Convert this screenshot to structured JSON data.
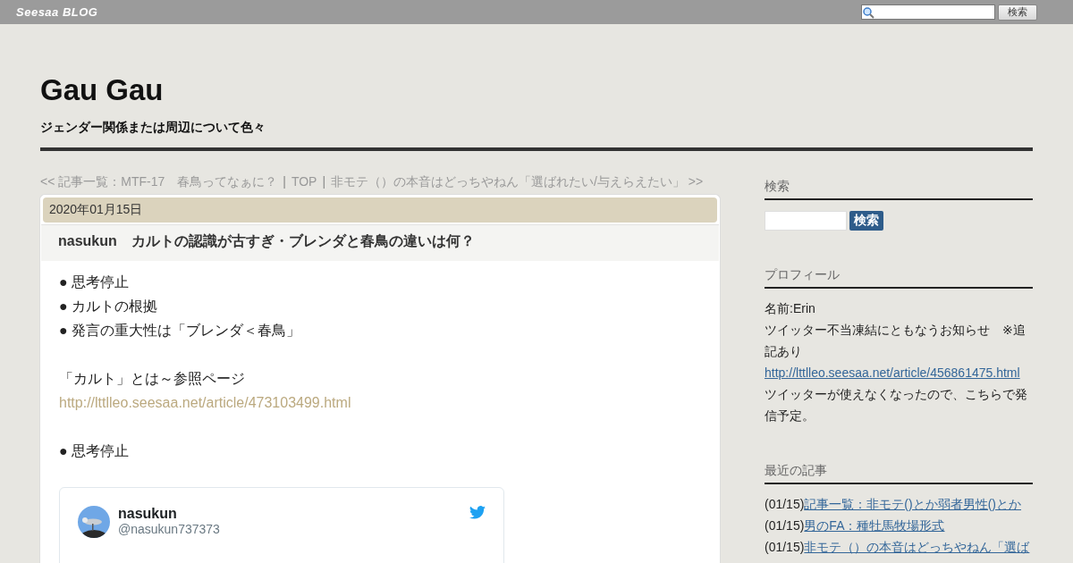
{
  "topbar": {
    "logo": "Seesaa BLOG",
    "search_button": "検索"
  },
  "blog": {
    "title": "Gau Gau",
    "subtitle": "ジェンダー関係または周辺について色々"
  },
  "nav": [
    {
      "kind": "link",
      "text": "<< 記事一覧：MTF-17　春鳥ってなぁに？"
    },
    {
      "kind": "sep",
      "text": "|"
    },
    {
      "kind": "link",
      "text": "TOP"
    },
    {
      "kind": "sep",
      "text": "|"
    },
    {
      "kind": "link",
      "text": "非モテ（）の本音はどっちやねん「選ばれたい/与えらえたい」 >>"
    }
  ],
  "article": {
    "date": "2020年01月15日",
    "title": "nasukun　カルトの認識が古すぎ・ブレンダと春鳥の違いは何？",
    "blocks": [
      [
        {
          "kind": "text",
          "text": "● 思考停止"
        },
        {
          "kind": "text",
          "text": "● カルトの根拠"
        },
        {
          "kind": "text",
          "text": "● 発言の重大性は「ブレンダ＜春鳥」"
        }
      ],
      [
        {
          "kind": "text",
          "text": "「カルト」とは～参照ページ"
        },
        {
          "kind": "link",
          "text": "http://lttlleo.seesaa.net/article/473103499.html"
        }
      ],
      [
        {
          "kind": "text",
          "text": "● 思考停止"
        }
      ]
    ],
    "tweet": {
      "name": "nasukun",
      "handle": "@nasukun737373"
    }
  },
  "sidebar": {
    "search": {
      "heading": "検索",
      "button": "検索"
    },
    "profile": {
      "heading": "プロフィール",
      "lines": [
        {
          "kind": "text",
          "text": "名前:Erin"
        },
        {
          "kind": "text",
          "text": "ツイッター不当凍結にともなうお知らせ　※追記あり"
        },
        {
          "kind": "link",
          "text": "http://lttlleo.seesaa.net/article/456861475.html"
        },
        {
          "kind": "text",
          "text": "ツイッターが使えなくなったので、こちらで発信予定。"
        }
      ]
    },
    "recent": {
      "heading": "最近の記事",
      "items": [
        {
          "date": "(01/15)",
          "title": "記事一覧：非モテ()とか弱者男性()とか"
        },
        {
          "date": "(01/15)",
          "title": "男のFA：種牡馬牧場形式"
        },
        {
          "date": "(01/15)",
          "title": "非モテ（）の本音はどっちやねん「選ば"
        }
      ]
    }
  }
}
